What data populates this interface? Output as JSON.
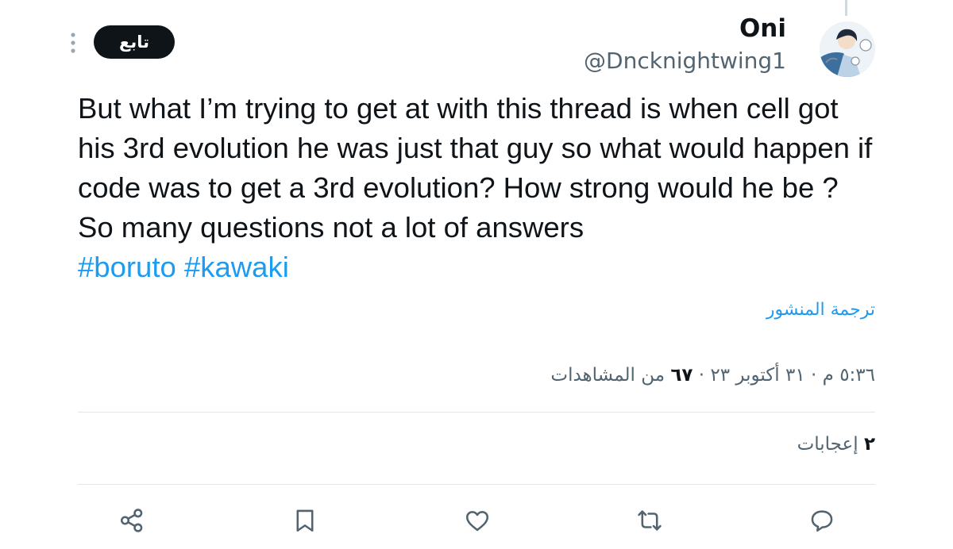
{
  "author": {
    "display_name": "Oni",
    "handle": "@Dncknightwing1"
  },
  "header": {
    "follow_label": "تابع",
    "more_icon": "more-vertical-icon"
  },
  "tweet": {
    "text": "But what I’m trying to get at with this thread is when cell got his 3rd evolution he was just that guy so what would happen if code was to get a 3rd evolution? How strong would he be ? So many questions not a lot of answers",
    "hashtags": [
      "#boruto",
      "#kawaki"
    ],
    "translate_label": "ترجمة المنشور"
  },
  "meta": {
    "time": "٥:٣٦ م",
    "separator": "·",
    "date": "٣١ أكتوبر ٢٣",
    "views_count": "٦٧",
    "views_label": "من المشاهدات"
  },
  "stats": {
    "likes_count": "٢",
    "likes_label": "إعجابات"
  },
  "actions": [
    {
      "name": "reply",
      "icon": "reply-icon"
    },
    {
      "name": "retweet",
      "icon": "retweet-icon"
    },
    {
      "name": "like",
      "icon": "heart-icon"
    },
    {
      "name": "bookmark",
      "icon": "bookmark-icon"
    },
    {
      "name": "share",
      "icon": "share-icon"
    }
  ],
  "colors": {
    "link": "#1d9bf0",
    "secondary_text": "#536471",
    "primary_text": "#0f1419",
    "icon": "#536471",
    "follow_bg": "#0f1419"
  }
}
